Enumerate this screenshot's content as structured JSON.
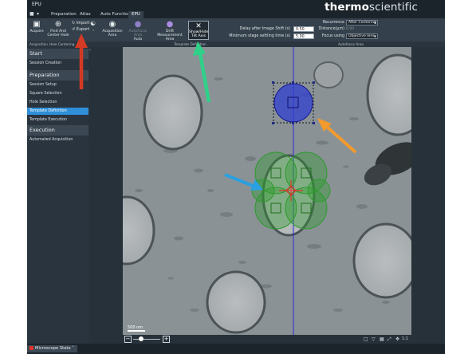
{
  "window": {
    "title": "EPU"
  },
  "brand": {
    "part1": "thermo",
    "part2": "scientific"
  },
  "tabs": [
    {
      "label": "Preparation"
    },
    {
      "label": "Atlas"
    },
    {
      "label": "Auto Functions"
    },
    {
      "label": "EPU",
      "active": true
    }
  ],
  "ribbon": {
    "acquire": "Acquire",
    "find_center_1": "Find And",
    "find_center_2": "Center Hole",
    "import": "Import",
    "export": "Export",
    "acq_area_1": "Acquisition",
    "acq_area_2": "Area",
    "autofocus_1": "Autofocus Area",
    "autofocus_2": "Auto",
    "drift_1": "Drift",
    "drift_2": "Measurement Area",
    "showhide_1": "Show/Hide",
    "showhide_2": "Tilt Axis",
    "delay_label": "Delay after Image Shift (s)",
    "delay_value": "0.50",
    "settle_label": "Minimum stage settling time (s)",
    "settle_value": "5.00",
    "recurrence_label": "Recurrence",
    "recurrence_value": "After Centering",
    "distance_label": "Distance(µm)",
    "distance_value": "0.00",
    "focus_label": "Focus using",
    "focus_value": "Objective lens",
    "groups": {
      "acquisition": "Acquisition",
      "hole_centering": "Hole Centering",
      "template_definition": "Template Definition",
      "autofocus_area": "Autofocus Area"
    }
  },
  "sidebar": {
    "start": "Start",
    "session_creation": "Session Creation",
    "preparation": "Preparation",
    "prep_items": [
      "Session Setup",
      "Square Selection",
      "Hole Selection",
      "Template Definition",
      "Template Execution"
    ],
    "execution": "Execution",
    "automated": "Automated Acquisition"
  },
  "viewport": {
    "scale_label": "500 nm"
  },
  "zoom": {
    "minus": "−",
    "plus": "+",
    "one_to_one": "1:1"
  },
  "status": {
    "microscope_state": "Microscope State"
  },
  "colors": {
    "accent_blue": "#2f8fd8",
    "tilt_axis": "#2b2bd6",
    "acquisition_green": "#2e9a2e",
    "drift_blue": "#2f3fd0",
    "center_red": "#e0312c",
    "arrow_green": "#2fd188",
    "arrow_red": "#d43a24",
    "arrow_orange": "#f39a2e",
    "arrow_blue": "#2aa0e0"
  },
  "icons": [
    "camera-icon",
    "find-center-icon",
    "import-icon",
    "export-icon",
    "acquisition-area-icon",
    "autofocus-icon",
    "drift-icon",
    "tilt-axis-icon"
  ]
}
